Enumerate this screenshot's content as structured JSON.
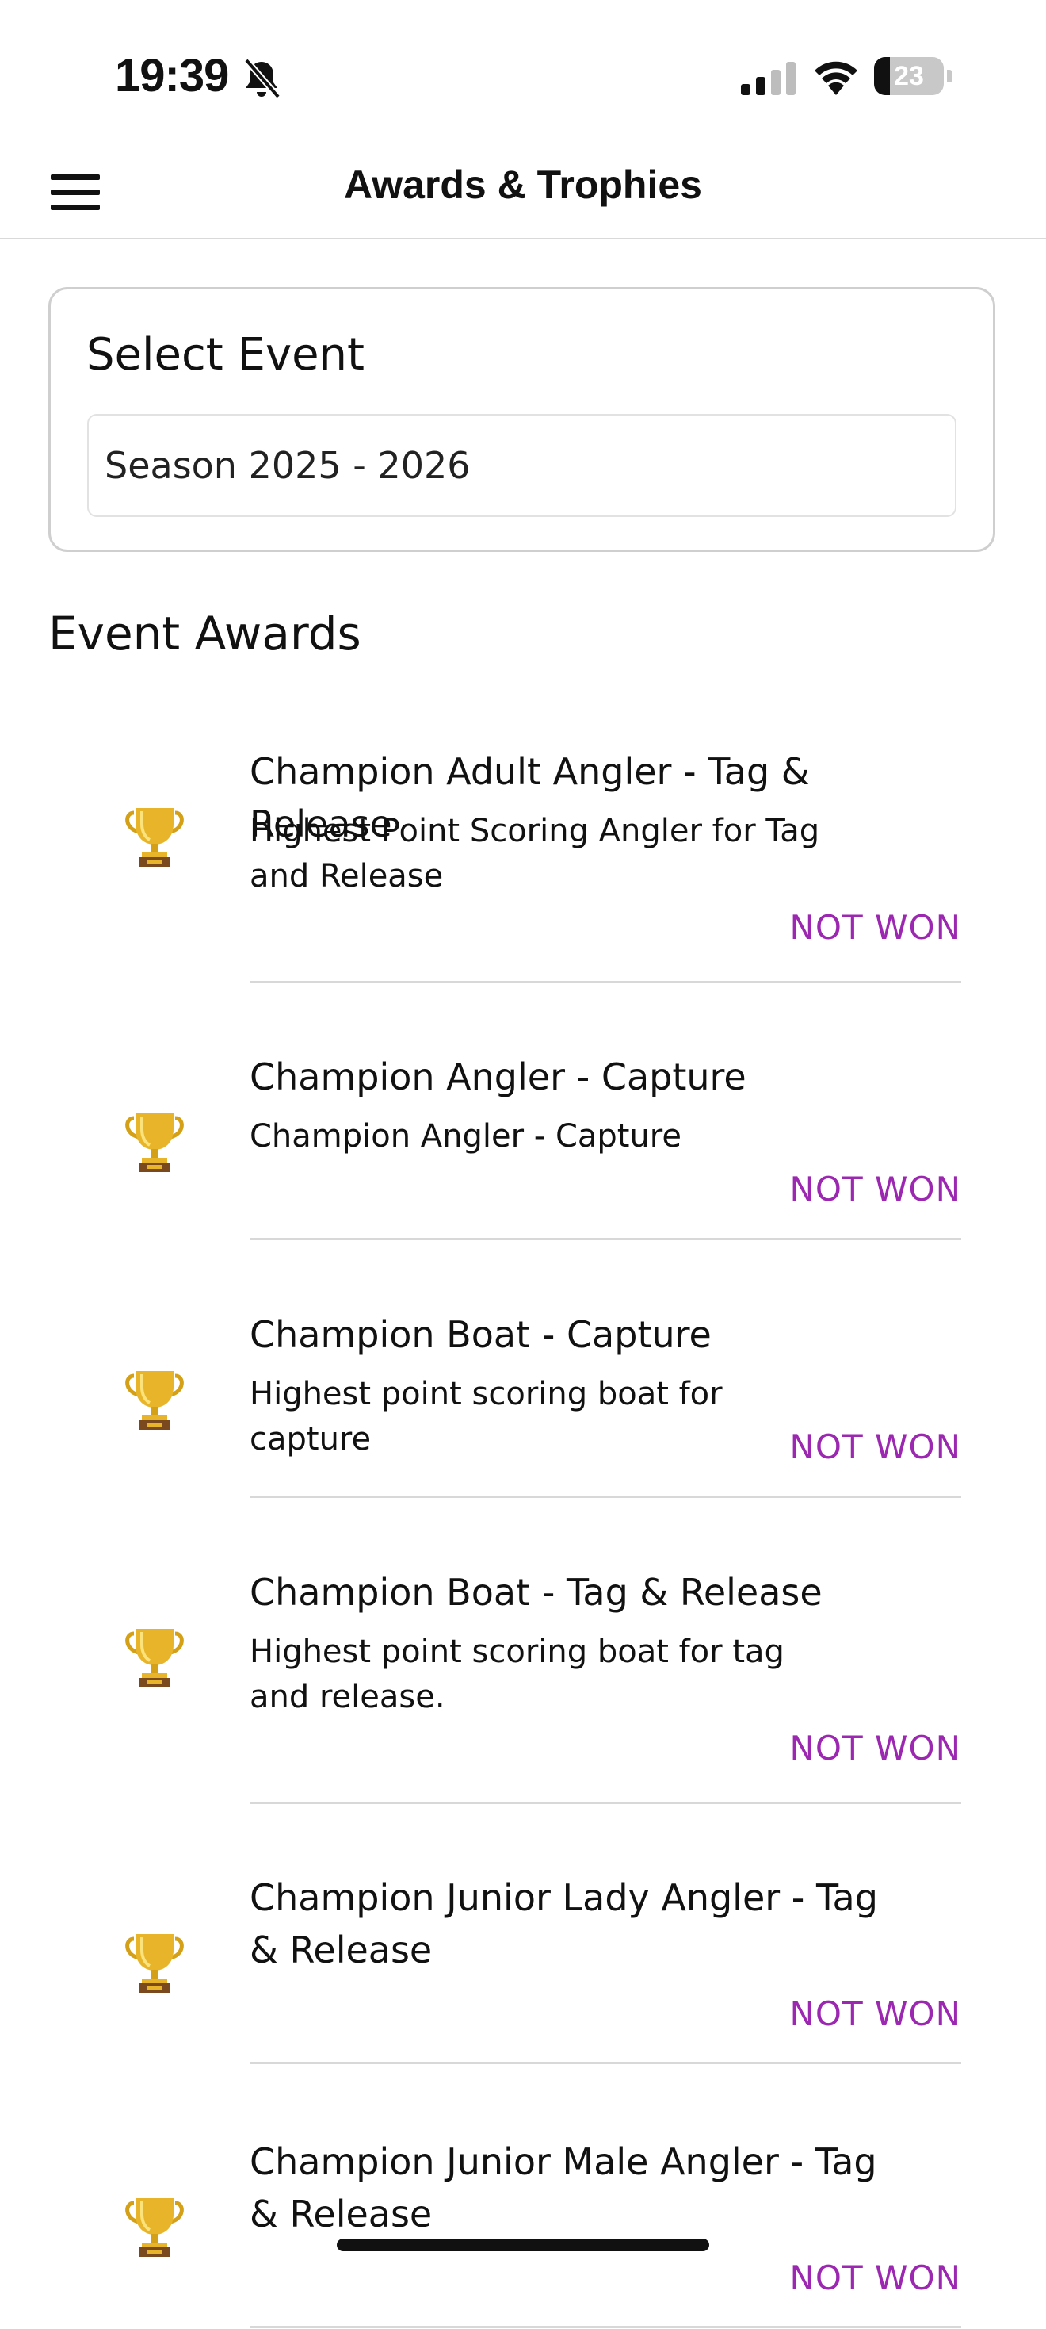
{
  "status_bar": {
    "time": "19:39",
    "battery_level": "23",
    "battery_fraction": 0.23
  },
  "nav": {
    "title": "Awards & Trophies",
    "menu_icon": "hamburger-menu-icon"
  },
  "event_select": {
    "label": "Select Event",
    "selected": "Season 2025 - 2026"
  },
  "awards_section": {
    "title": "Event Awards"
  },
  "awards": [
    {
      "title": "Champion Adult Angler - Tag & Release",
      "description": "Highest Point Scoring Angler for Tag and Release",
      "status": "NOT WON"
    },
    {
      "title": "Champion Angler - Capture",
      "description": "Champion Angler - Capture",
      "status": "NOT WON"
    },
    {
      "title": "Champion Boat - Capture",
      "description": "Highest point scoring boat for capture",
      "status": "NOT WON"
    },
    {
      "title": "Champion Boat - Tag & Release",
      "description": "Highest point scoring boat for tag and release.",
      "status": "NOT WON"
    },
    {
      "title": "Champion Junior Lady Angler - Tag & Release",
      "description": "",
      "status": "NOT WON"
    },
    {
      "title": "Champion Junior Male Angler - Tag & Release",
      "description": "",
      "status": "NOT WON"
    }
  ],
  "colors": {
    "status_not_won": "#9c27b0",
    "divider": "#d8d8d8"
  }
}
